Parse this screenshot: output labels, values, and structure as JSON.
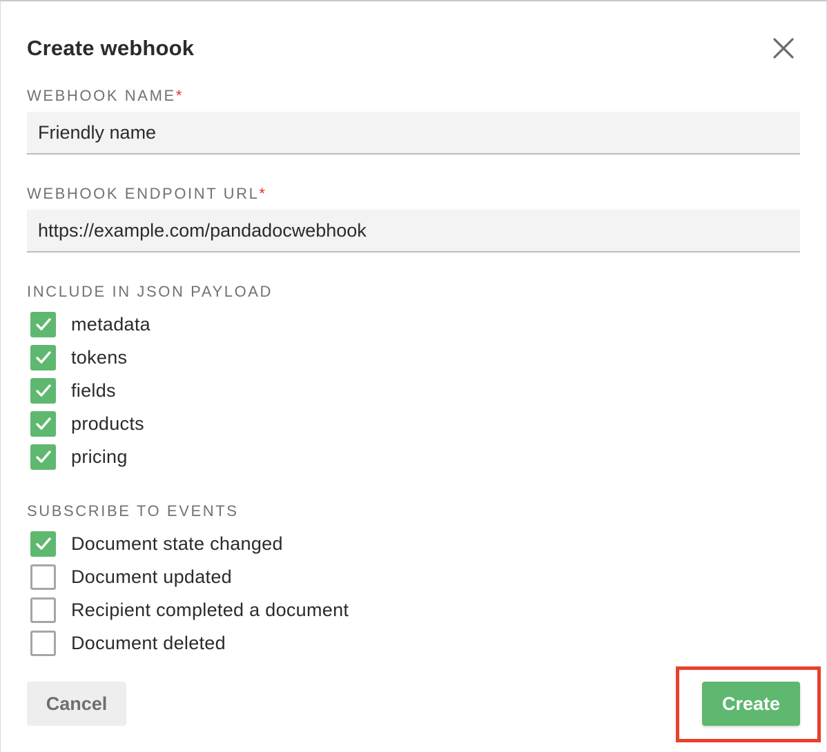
{
  "dialog": {
    "title": "Create webhook",
    "close_icon": "close-icon"
  },
  "fields": {
    "name": {
      "label": "WEBHOOK NAME",
      "required_mark": "*",
      "value": "Friendly name"
    },
    "url": {
      "label": "WEBHOOK ENDPOINT URL",
      "required_mark": "*",
      "value": "https://example.com/pandadocwebhook"
    }
  },
  "payload": {
    "label": "INCLUDE IN JSON PAYLOAD",
    "options": [
      {
        "label": "metadata",
        "checked": true
      },
      {
        "label": "tokens",
        "checked": true
      },
      {
        "label": "fields",
        "checked": true
      },
      {
        "label": "products",
        "checked": true
      },
      {
        "label": "pricing",
        "checked": true
      }
    ]
  },
  "events": {
    "label": "SUBSCRIBE TO EVENTS",
    "options": [
      {
        "label": "Document state changed",
        "checked": true
      },
      {
        "label": "Document updated",
        "checked": false
      },
      {
        "label": "Recipient completed a document",
        "checked": false
      },
      {
        "label": "Document deleted",
        "checked": false
      }
    ]
  },
  "buttons": {
    "cancel": "Cancel",
    "create": "Create"
  },
  "colors": {
    "accent_green": "#5eb86f",
    "required_red": "#d9352b",
    "highlight_red": "#e8402a"
  }
}
